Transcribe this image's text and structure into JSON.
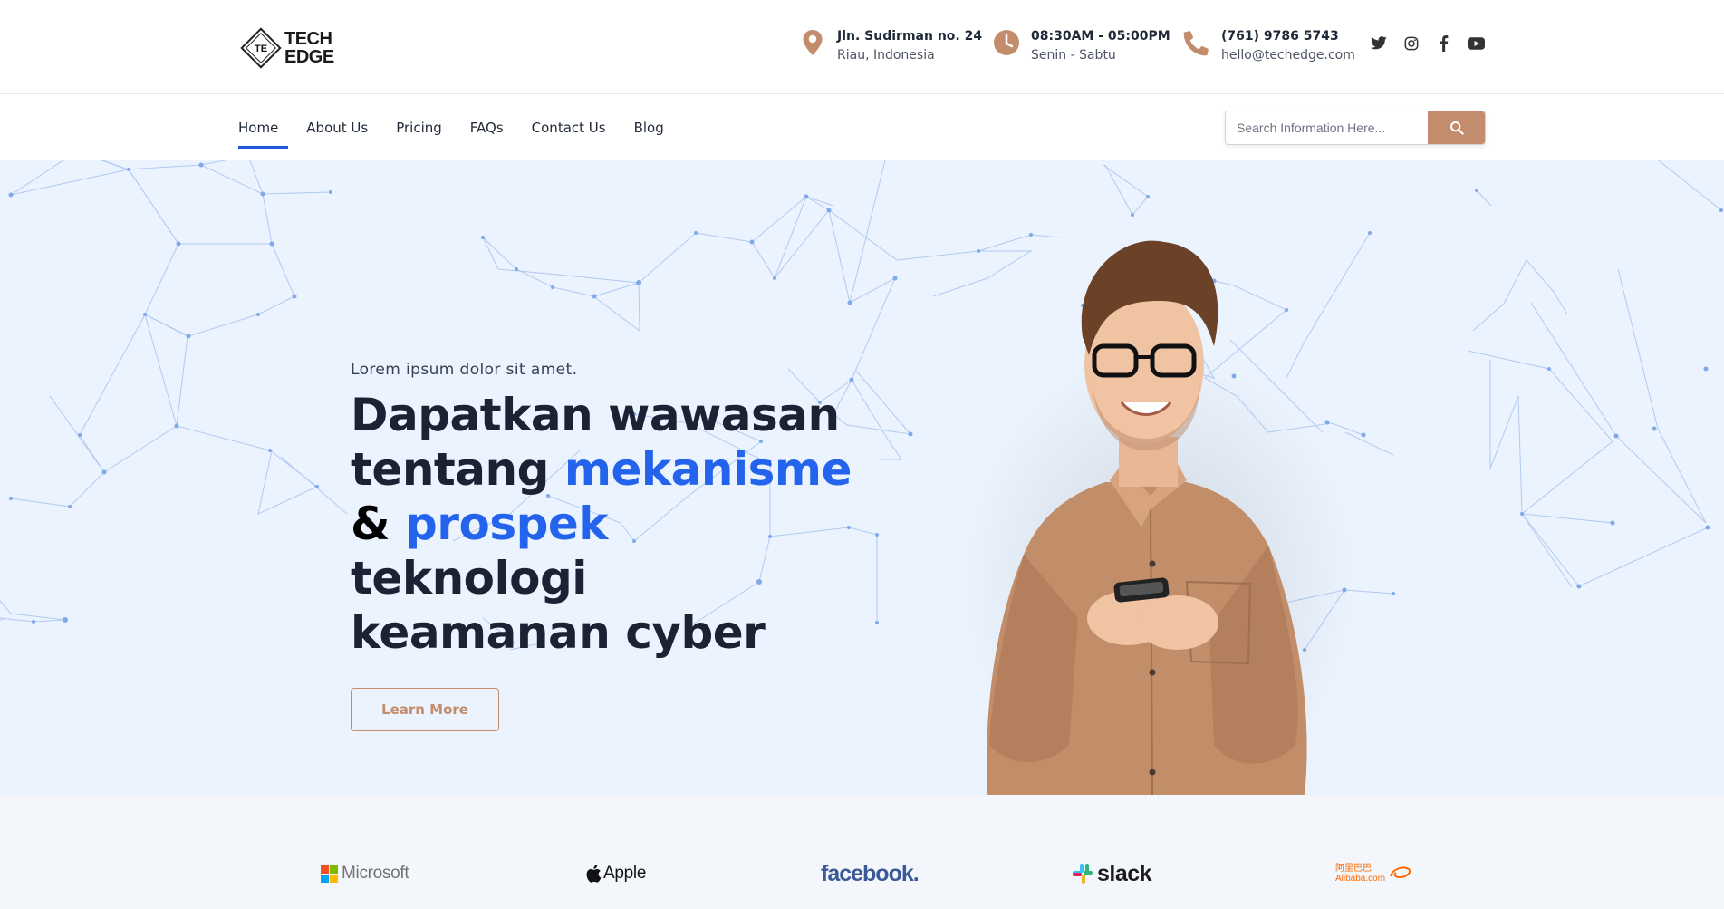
{
  "logo": {
    "mark": "TE",
    "line1": "TECH",
    "line2": "EDGE"
  },
  "contact": {
    "address": {
      "icon": "map-pin-icon",
      "line1": "Jln. Sudirman no. 24",
      "line2": "Riau, Indonesia"
    },
    "hours": {
      "icon": "clock-icon",
      "line1": "08:30AM - 05:00PM",
      "line2": "Senin - Sabtu"
    },
    "phone": {
      "icon": "phone-icon",
      "line1": "(761) 9786 5743",
      "line2": "hello@techedge.com"
    }
  },
  "socials": [
    "twitter-icon",
    "instagram-icon",
    "facebook-icon",
    "youtube-icon"
  ],
  "nav": {
    "items": [
      {
        "label": "Home",
        "active": true
      },
      {
        "label": "About Us"
      },
      {
        "label": "Pricing"
      },
      {
        "label": "FAQs"
      },
      {
        "label": "Contact Us"
      },
      {
        "label": "Blog"
      }
    ]
  },
  "search": {
    "placeholder": "Search Information Here...",
    "value": ""
  },
  "hero": {
    "kicker": "Lorem ipsum dolor sit amet.",
    "line1": "Dapatkan wawasan",
    "line2_a": "tentang ",
    "line2_b": "mekanisme",
    "line3_a": "& ",
    "line3_b": "prospek",
    "line3_c": " teknologi",
    "line4": "keamanan cyber",
    "cta": "Learn More"
  },
  "brands": [
    {
      "name": "Microsoft"
    },
    {
      "name": "Apple"
    },
    {
      "name": "facebook."
    },
    {
      "name": "slack"
    },
    {
      "name": "Alibaba.com",
      "sub": "阿里巴巴"
    }
  ],
  "colors": {
    "accent": "#c38d6d",
    "primary_blue": "#2463eb",
    "hero_bg": "#ebf3fe",
    "nav_active": "#1f57d6"
  }
}
